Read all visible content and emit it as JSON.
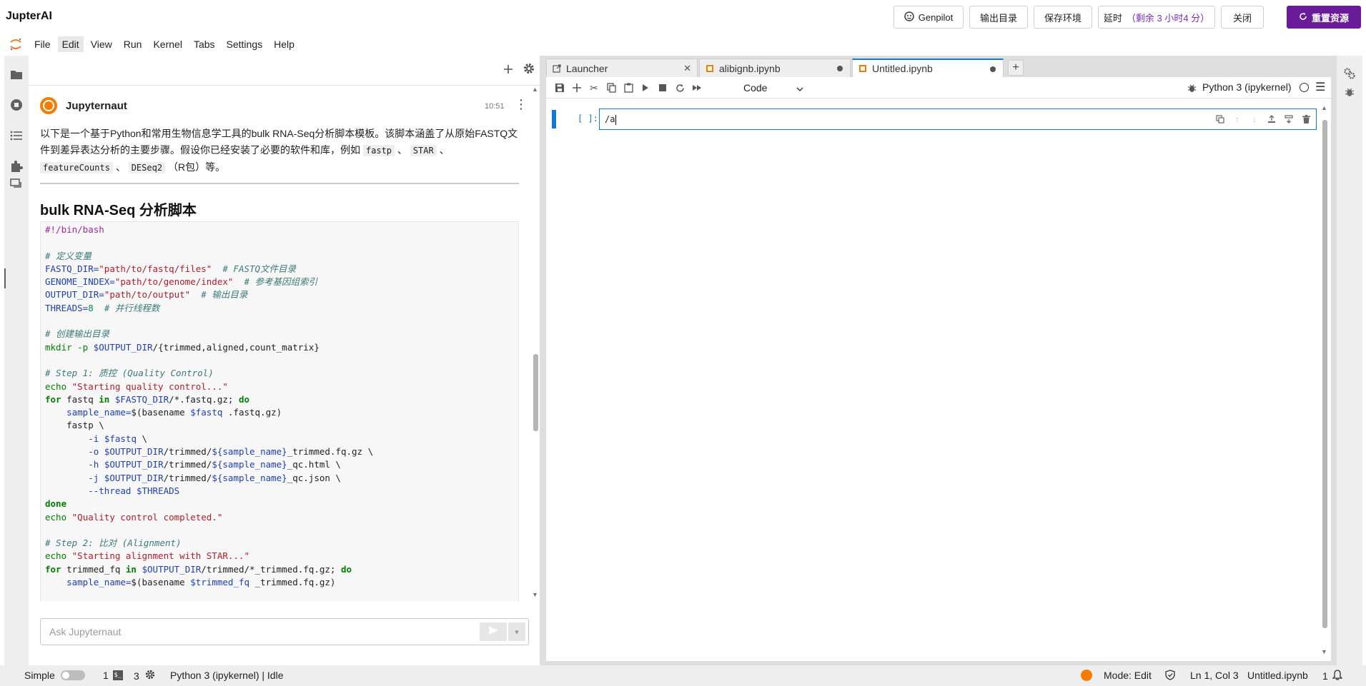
{
  "app": {
    "title": "JupterAI"
  },
  "top_buttons": {
    "genpilot": "Genpilot",
    "output_dir": "输出目录",
    "save_env": "保存环境",
    "extend": "延时",
    "extend_note": "（剩余 3 小时4 分）",
    "close": "关闭",
    "reset": "重置资源"
  },
  "menu": {
    "items": [
      "File",
      "Edit",
      "View",
      "Run",
      "Kernel",
      "Tabs",
      "Settings",
      "Help"
    ],
    "active": "Edit"
  },
  "chat": {
    "author": "Jupyternaut",
    "time": "10:51",
    "intro_1": "以下是一个基于Python和常用生物信息学工具的bulk RNA-Seq分析脚本模板。该脚本涵盖了从原始FASTQ文件到差异表达分析的主要步骤。假设你已经安装了必要的软件和库，例如",
    "code_1": "fastp",
    "sep_1": "、",
    "code_2": "STAR",
    "sep_2": "、",
    "code_3": "featureCounts",
    "sep_3": "、",
    "code_4": "DESeq2",
    "intro_2": "（R包）等。",
    "heading": "bulk RNA-Seq 分析脚本",
    "input_placeholder": "Ask Jupyternaut",
    "code": {
      "l1": "#!/bin/bash",
      "c_define": "# 定义变量",
      "fastq_dir_var": "FASTQ_DIR=",
      "fastq_dir_val": "\"path/to/fastq/files\"",
      "fastq_dir_cm": "# FASTQ文件目录",
      "genome_var": "GENOME_INDEX=",
      "genome_val": "\"path/to/genome/index\"",
      "genome_cm": "# 参考基因组索引",
      "out_var": "OUTPUT_DIR=",
      "out_val": "\"path/to/output\"",
      "out_cm": "# 输出目录",
      "threads_var": "THREADS=",
      "threads_val": "8",
      "threads_cm": "# 并行线程数",
      "c_mkdir": "# 创建输出目录",
      "mkdir_cmd": "mkdir -p",
      "mkdir_var": "$OUTPUT_DIR",
      "mkdir_rest": "/{trimmed,aligned,count_matrix}",
      "c_step1": "# Step 1: 质控 (Quality Control)",
      "echo": "echo",
      "echo1_str": "\"Starting quality control...\"",
      "for": "for",
      "in": "in",
      "do": "do",
      "done": "done",
      "fastq": "fastq",
      "fastq_dir_ref": "$FASTQ_DIR",
      "glob1": "/*.fastq.gz;",
      "sample_assign": "sample_name=",
      "basename_1": "$(basename",
      "fastq_ref": "$fastq",
      "basename_1_tail": ".fastq.gz)",
      "fastp": "fastp \\",
      "opt_i": "-i",
      "opt_o": "-o",
      "opt_h": "-h",
      "opt_j": "-j",
      "opt_thread": "--thread",
      "threads_ref": "$THREADS",
      "out_ref": "$OUTPUT_DIR",
      "sample_ref": "${sample_name}",
      "trimmed_path": "/trimmed/",
      "trimmed_suffix": "_trimmed.fq.gz \\",
      "qc_html": "_qc.html \\",
      "qc_json": "_qc.json \\",
      "bs": "\\",
      "echo2_str": "\"Quality control completed.\"",
      "c_step2": "# Step 2: 比对 (Alignment)",
      "echo3_str": "\"Starting alignment with STAR...\"",
      "trimmed_fq": "trimmed_fq",
      "glob2": "/trimmed/*_trimmed.fq.gz;",
      "trimmed_fq_ref": "$trimmed_fq",
      "basename_2_tail": "_trimmed.fq.gz)"
    }
  },
  "tabs": [
    {
      "label": "Launcher",
      "icon": "launcher-icon",
      "active": false,
      "dirty": false
    },
    {
      "label": "alibignb.ipynb",
      "icon": "notebook-icon",
      "active": false,
      "dirty": true
    },
    {
      "label": "Untitled.ipynb",
      "icon": "notebook-icon",
      "active": true,
      "dirty": true
    }
  ],
  "notebook": {
    "cell_type": "Code",
    "kernel": "Python 3 (ipykernel)",
    "cell_prompt": "[ ]:",
    "cell_source": "/a"
  },
  "status": {
    "mode_label": "Simple",
    "terminals": "1",
    "kernels": "3",
    "kernel_status": "Python 3 (ipykernel) | Idle",
    "mode": "Mode: Edit",
    "cursor": "Ln 1, Col 3",
    "file": "Untitled.ipynb",
    "notifications": "1"
  },
  "colors": {
    "accent": "#1976d2",
    "brand": "#f57c00",
    "primary_button": "#6a1b9a"
  }
}
